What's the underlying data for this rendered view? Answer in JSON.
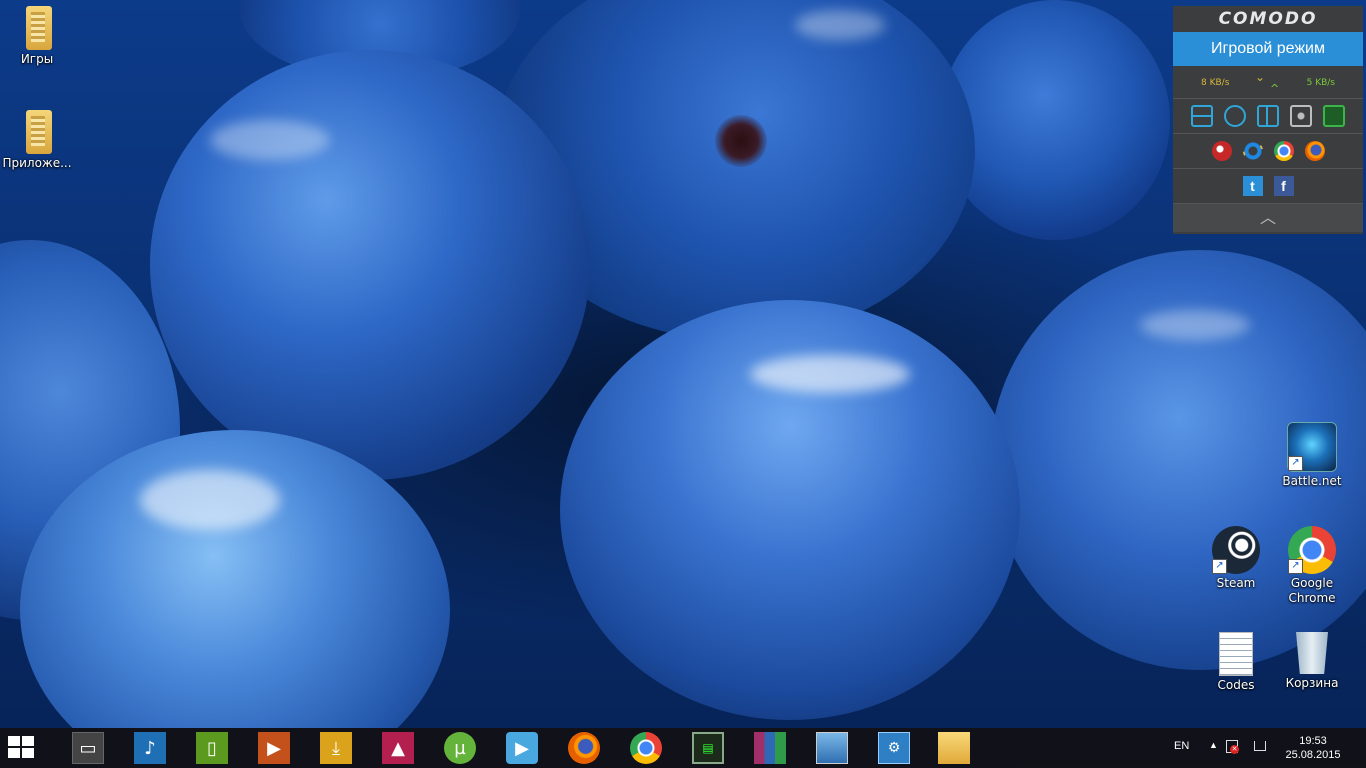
{
  "desktop": {
    "icons": [
      {
        "label": "Игры"
      },
      {
        "label": "Приложе..."
      },
      {
        "label": "Battle.net"
      },
      {
        "label": "Steam"
      },
      {
        "label": "Google Chrome"
      },
      {
        "label": "Codes"
      },
      {
        "label": "Корзина"
      }
    ]
  },
  "comodo": {
    "logo": "COMODO",
    "mode": "Игровой режим",
    "download": "8 KB/s",
    "upload": "5 KB/s",
    "accent": "#2a8fd6",
    "tools": [
      "task-manager-icon",
      "update-icon",
      "widgets-icon",
      "virtual-desktop-icon",
      "support-icon"
    ],
    "browsers": [
      "comodo-dragon-icon",
      "internet-explorer-icon",
      "chrome-icon",
      "firefox-icon"
    ],
    "social": {
      "twitter": "t",
      "facebook": "f"
    }
  },
  "taskbar": {
    "apps": [
      "desktop-icon",
      "music-icon",
      "file-icon",
      "video-icon",
      "download-icon",
      "photos-icon",
      "utorrent-icon",
      "media-player-icon",
      "firefox-icon",
      "chrome-icon",
      "monitor-icon",
      "winrar-icon",
      "image-viewer-icon",
      "control-panel-icon",
      "file-explorer-icon"
    ],
    "language": "EN",
    "time": "19:53",
    "date": "25.08.2015"
  }
}
